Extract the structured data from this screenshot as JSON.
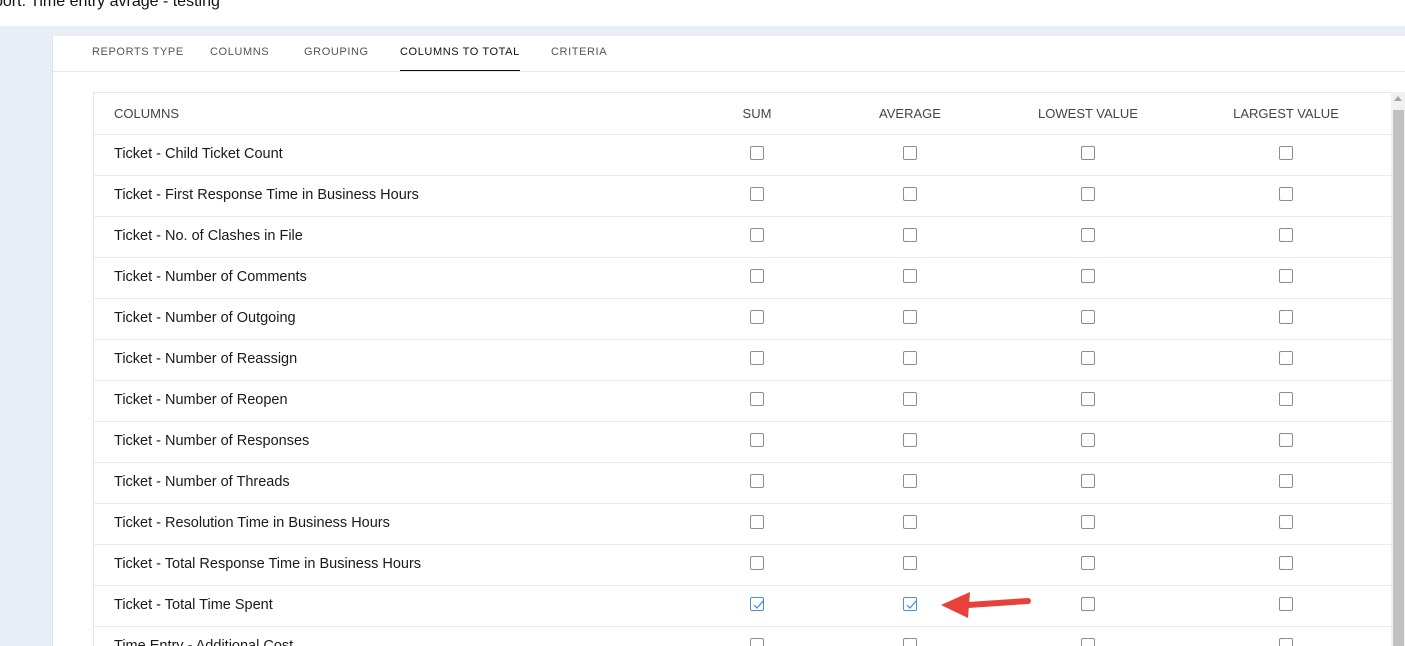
{
  "page": {
    "title": "port: Time entry avrage - testing"
  },
  "tabs": [
    {
      "label": "REPORTS TYPE"
    },
    {
      "label": "COLUMNS"
    },
    {
      "label": "GROUPING"
    },
    {
      "label": "COLUMNS TO TOTAL",
      "active": true
    },
    {
      "label": "CRITERIA"
    }
  ],
  "table": {
    "headers": {
      "columns": "COLUMNS",
      "sum": "SUM",
      "average": "AVERAGE",
      "lowest": "LOWEST VALUE",
      "largest": "LARGEST VALUE"
    },
    "rows": [
      {
        "label": "Ticket - Child Ticket Count",
        "sum": false,
        "average": false,
        "lowest": false,
        "largest": false
      },
      {
        "label": "Ticket - First Response Time in Business Hours",
        "sum": false,
        "average": false,
        "lowest": false,
        "largest": false
      },
      {
        "label": "Ticket - No. of Clashes in File",
        "sum": false,
        "average": false,
        "lowest": false,
        "largest": false
      },
      {
        "label": "Ticket - Number of Comments",
        "sum": false,
        "average": false,
        "lowest": false,
        "largest": false
      },
      {
        "label": "Ticket - Number of Outgoing",
        "sum": false,
        "average": false,
        "lowest": false,
        "largest": false
      },
      {
        "label": "Ticket - Number of Reassign",
        "sum": false,
        "average": false,
        "lowest": false,
        "largest": false
      },
      {
        "label": "Ticket - Number of Reopen",
        "sum": false,
        "average": false,
        "lowest": false,
        "largest": false
      },
      {
        "label": "Ticket - Number of Responses",
        "sum": false,
        "average": false,
        "lowest": false,
        "largest": false
      },
      {
        "label": "Ticket - Number of Threads",
        "sum": false,
        "average": false,
        "lowest": false,
        "largest": false
      },
      {
        "label": "Ticket - Resolution Time in Business Hours",
        "sum": false,
        "average": false,
        "lowest": false,
        "largest": false
      },
      {
        "label": "Ticket - Total Response Time in Business Hours",
        "sum": false,
        "average": false,
        "lowest": false,
        "largest": false
      },
      {
        "label": "Ticket - Total Time Spent",
        "sum": true,
        "average": true,
        "lowest": false,
        "largest": false
      },
      {
        "label": "Time Entry - Additional Cost",
        "sum": false,
        "average": false,
        "lowest": false,
        "largest": false
      }
    ]
  },
  "colors": {
    "accent": "#4a90d9",
    "annotation_arrow": "#e8413c",
    "background": "#e9edf5"
  },
  "icons": {
    "checkbox_checked": "checkmark-icon",
    "annotation": "red-arrow-icon",
    "scroll_up": "scroll-up-arrow-icon"
  }
}
